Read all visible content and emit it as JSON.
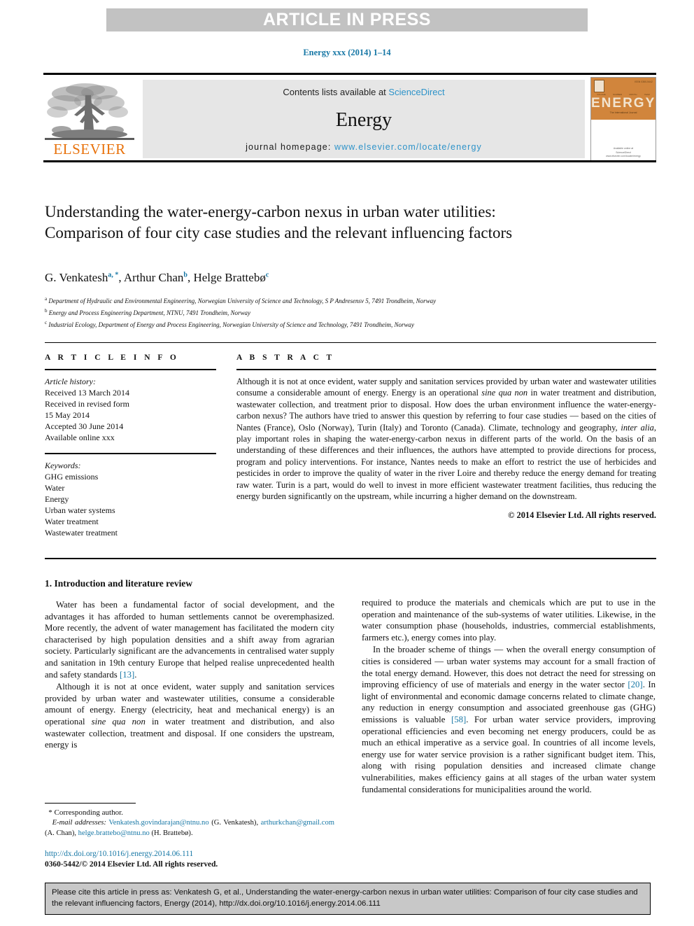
{
  "banner": {
    "text": "ARTICLE IN PRESS"
  },
  "running_head": "Energy xxx (2014) 1–14",
  "journal_header": {
    "contents_prefix": "Contents lists available at ",
    "contents_link": "ScienceDirect",
    "journal_title": "Energy",
    "homepage_label": "journal homepage: ",
    "homepage_url": "www.elsevier.com/locate/energy",
    "publisher_wordmark": "ELSEVIER",
    "cover": {
      "title": "ENERGY",
      "subtitle": "The International Journal",
      "corner_text": "ISSN 0360-5442",
      "row_labels": [
        "VOLUME",
        "NUMBER",
        "MONTH",
        "YEAR"
      ],
      "footer_line1": "Available online at",
      "footer_line2": "ScienceDirect",
      "footer_line3": "www.elsevier.com/locate/energy"
    }
  },
  "article": {
    "title": "Understanding the water-energy-carbon nexus in urban water utilities: Comparison of four city case studies and the relevant influencing factors",
    "authors": [
      {
        "name": "G. Venkatesh",
        "marks": "a, *"
      },
      {
        "name": "Arthur Chan",
        "marks": "b"
      },
      {
        "name": "Helge Brattebø",
        "marks": "c"
      }
    ],
    "affiliations": [
      {
        "mark": "a",
        "text": "Department of Hydraulic and Environmental Engineering, Norwegian University of Science and Technology, S P Andresensv 5, 7491 Trondheim, Norway"
      },
      {
        "mark": "b",
        "text": "Energy and Process Engineering Department, NTNU, 7491 Trondheim, Norway"
      },
      {
        "mark": "c",
        "text": "Industrial Ecology, Department of Energy and Process Engineering, Norwegian University of Science and Technology, 7491 Trondheim, Norway"
      }
    ]
  },
  "article_info": {
    "label": "A R T I C L E   I N F O",
    "history_label": "Article history:",
    "history": [
      "Received 13 March 2014",
      "Received in revised form",
      "15 May 2014",
      "Accepted 30 June 2014",
      "Available online xxx"
    ],
    "keywords_label": "Keywords:",
    "keywords": [
      "GHG emissions",
      "Water",
      "Energy",
      "Urban water systems",
      "Water treatment",
      "Wastewater treatment"
    ]
  },
  "abstract": {
    "label": "A B S T R A C T",
    "part1": "Although it is not at once evident, water supply and sanitation services provided by urban water and wastewater utilities consume a considerable amount of energy. Energy is an operational ",
    "italic1": "sine qua non",
    "part2": " in water treatment and distribution, wastewater collection, and treatment prior to disposal. How does the urban environment influence the water-energy-carbon nexus? The authors have tried to answer this question by referring to four case studies — based on the cities of Nantes (France), Oslo (Norway), Turin (Italy) and Toronto (Canada). Climate, technology and geography, ",
    "italic2": "inter alia",
    "part3": ", play important roles in shaping the water-energy-carbon nexus in different parts of the world. On the basis of an understanding of these differences and their influences, the authors have attempted to provide directions for process, program and policy interventions. For instance, Nantes needs to make an effort to restrict the use of herbicides and pesticides in order to improve the quality of water in the river Loire and thereby reduce the energy demand for treating raw water. Turin is a part, would do well to invest in more efficient wastewater treatment facilities, thus reducing the energy burden significantly on the upstream, while incurring a higher demand on the downstream.",
    "copyright": "© 2014 Elsevier Ltd. All rights reserved."
  },
  "body": {
    "section_heading": "1. Introduction and literature review",
    "left_paragraphs": [
      {
        "text_before": "Water has been a fundamental factor of social development, and the advantages it has afforded to human settlements cannot be overemphasized. More recently, the advent of water management has facilitated the modern city characterised by high population densities and a shift away from agrarian society. Particularly significant are the advancements in centralised water supply and sanitation in 19th century Europe that helped realise unprecedented health and safety standards ",
        "ref": "[13]",
        "text_after": "."
      },
      {
        "text_before": "Although it is not at once evident, water supply and sanitation services provided by urban water and wastewater utilities, consume a considerable amount of energy. Energy (electricity, heat and mechanical energy) is an operational ",
        "italic": "sine qua non",
        "text_after": " in water treatment and distribution, and also wastewater collection, treatment and disposal. If one considers the upstream, energy is"
      }
    ],
    "right_paragraphs": [
      {
        "text_before": "required to produce the materials and chemicals which are put to use in the operation and maintenance of the sub-systems of water utilities. Likewise, in the water consumption phase (households, industries, commercial establishments, farmers etc.), energy comes into play.",
        "ref": "",
        "text_after": ""
      },
      {
        "text_before": "In the broader scheme of things — when the overall energy consumption of cities is considered — urban water systems may account for a small fraction of the total energy demand. However, this does not detract the need for stressing on improving efficiency of use of materials and energy in the water sector ",
        "ref": "[20]",
        "text_mid": ". In light of environmental and economic damage concerns related to climate change, any reduction in energy consumption and associated greenhouse gas (GHG) emissions is valuable ",
        "ref2": "[58]",
        "text_after": ". For urban water service providers, improving operational efficiencies and even becoming net energy producers, could be as much an ethical imperative as a service goal. In countries of all income levels, energy use for water service provision is a rather significant budget item. This, along with rising population densities and increased climate change vulnerabilities, makes efficiency gains at all stages of the urban water system fundamental considerations for municipalities around the world."
      }
    ]
  },
  "footnote": {
    "corresponding": "* Corresponding author.",
    "email_label": "E-mail addresses:",
    "emails": [
      {
        "address": "Venkatesh.govindarajan@ntnu.no",
        "owner": "(G. Venkatesh)"
      },
      {
        "address": "arthurkchan@gmail.com",
        "owner": "(A. Chan)"
      },
      {
        "address": "helge.brattebo@ntnu.no",
        "owner": "(H. Brattebø)"
      }
    ]
  },
  "doi_block": {
    "doi_url": "http://dx.doi.org/10.1016/j.energy.2014.06.111",
    "issn_line": "0360-5442/© 2014 Elsevier Ltd. All rights reserved."
  },
  "citation_box": {
    "text": "Please cite this article in press as: Venkatesh G, et al., Understanding the water-energy-carbon nexus in urban water utilities: Comparison of four city case studies and the relevant influencing factors, Energy (2014), http://dx.doi.org/10.1016/j.energy.2014.06.111"
  },
  "colors": {
    "link_blue": "#1878a6",
    "sd_blue": "#2e93c9",
    "elsevier_orange": "#e8710a",
    "banner_gray": "#c2c2c2",
    "band_gray": "#e6e6e6",
    "cite_gray": "#c8c8c8",
    "cover_orange": "#d1853c"
  }
}
